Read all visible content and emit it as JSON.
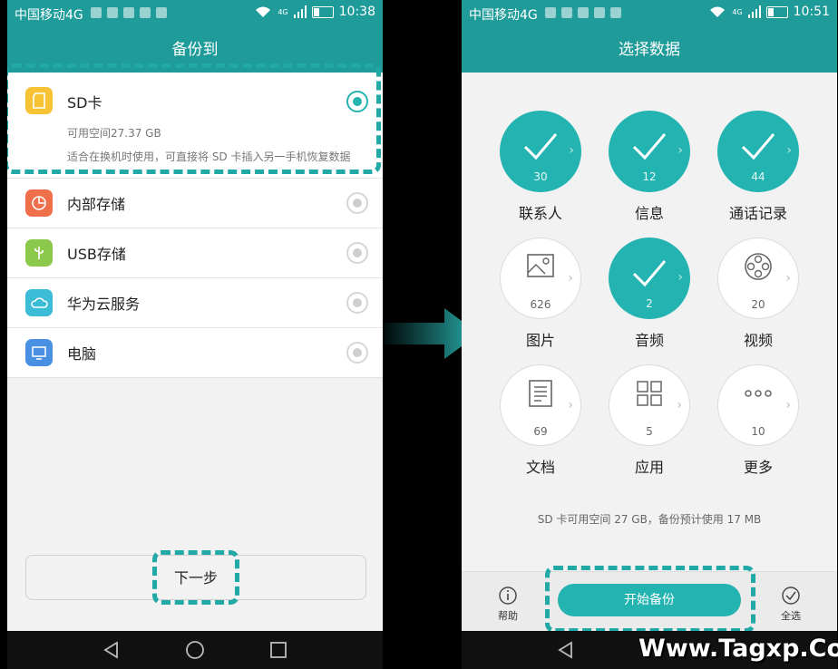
{
  "left": {
    "status": {
      "carrier": "中国移动4G",
      "net": "4G",
      "time": "10:38"
    },
    "title": "备份到",
    "sd": {
      "label": "SD卡",
      "space": "可用空间27.37 GB",
      "desc": "适合在换机时使用，可直接将 SD 卡插入另一手机恢复数据",
      "icon": "sd-card-icon",
      "color": "#f7c234"
    },
    "rows": [
      {
        "label": "内部存储",
        "icon": "pie-storage-icon",
        "color": "#f06f4b"
      },
      {
        "label": "USB存储",
        "icon": "usb-icon",
        "color": "#8cc84b"
      },
      {
        "label": "华为云服务",
        "icon": "cloud-icon",
        "color": "#3cbcd6"
      },
      {
        "label": "电脑",
        "icon": "monitor-icon",
        "color": "#4a90e2"
      }
    ],
    "next": "下一步"
  },
  "right": {
    "status": {
      "carrier": "中国移动4G",
      "net": "4G",
      "time": "10:51"
    },
    "title": "选择数据",
    "categories": [
      {
        "label": "联系人",
        "count": "30",
        "selected": true
      },
      {
        "label": "信息",
        "count": "12",
        "selected": true
      },
      {
        "label": "通话记录",
        "count": "44",
        "selected": true
      },
      {
        "label": "图片",
        "count": "626",
        "selected": false,
        "icon": "image-icon"
      },
      {
        "label": "音频",
        "count": "2",
        "selected": true
      },
      {
        "label": "视频",
        "count": "20",
        "selected": false,
        "icon": "film-reel-icon"
      },
      {
        "label": "文档",
        "count": "69",
        "selected": false,
        "icon": "document-icon"
      },
      {
        "label": "应用",
        "count": "5",
        "selected": false,
        "icon": "apps-grid-icon"
      },
      {
        "label": "更多",
        "count": "10",
        "selected": false,
        "icon": "more-dots-icon"
      }
    ],
    "info": "SD 卡可用空间 27 GB，备份预计使用 17 MB",
    "help": "帮助",
    "start": "开始备份",
    "select_all": "全选"
  },
  "watermark": "Www.Tagxp.Com",
  "colors": {
    "teal": "#1f9c99",
    "accent": "#23b3b0",
    "dash": "#21a9a6"
  }
}
